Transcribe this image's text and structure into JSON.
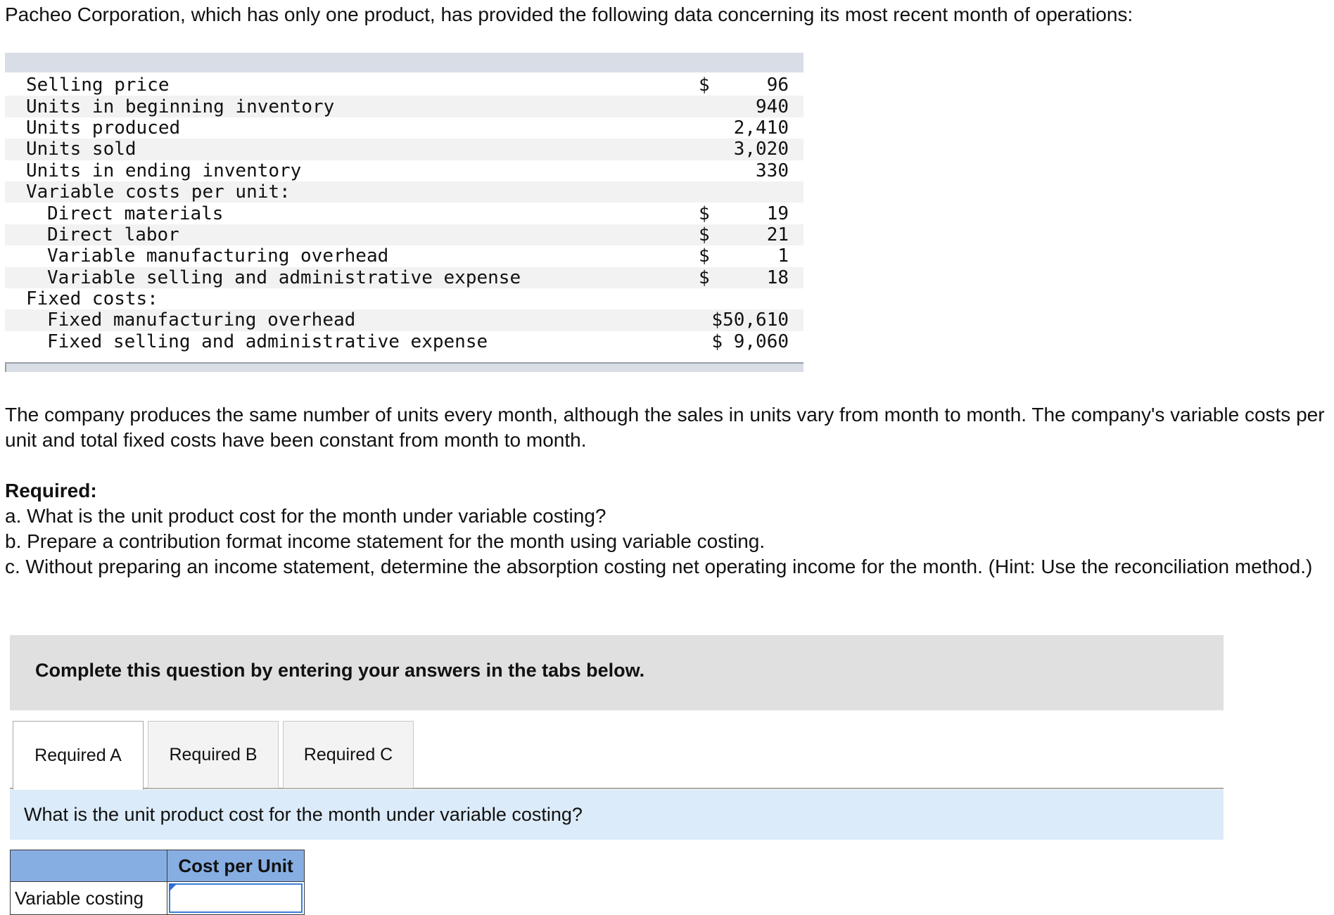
{
  "intro": "Pacheo Corporation, which has only one product, has provided the following data concerning its most recent month of operations:",
  "data_rows": [
    {
      "label": "Selling price",
      "cur": "$",
      "val": "96",
      "indent": false
    },
    {
      "label": "Units in beginning inventory",
      "cur": "",
      "val": "940",
      "indent": false
    },
    {
      "label": "Units produced",
      "cur": "",
      "val": "2,410",
      "indent": false
    },
    {
      "label": "Units sold",
      "cur": "",
      "val": "3,020",
      "indent": false
    },
    {
      "label": "Units in ending inventory",
      "cur": "",
      "val": "330",
      "indent": false
    },
    {
      "label": "Variable costs per unit:",
      "cur": "",
      "val": "",
      "indent": false
    },
    {
      "label": "Direct materials",
      "cur": "$",
      "val": "19",
      "indent": true
    },
    {
      "label": "Direct labor",
      "cur": "$",
      "val": "21",
      "indent": true
    },
    {
      "label": "Variable manufacturing overhead",
      "cur": "$",
      "val": "1",
      "indent": true
    },
    {
      "label": "Variable selling and administrative expense",
      "cur": "$",
      "val": "18",
      "indent": true
    },
    {
      "label": "Fixed costs:",
      "cur": "",
      "val": "",
      "indent": false
    },
    {
      "label": "Fixed manufacturing overhead",
      "combined": "$50,610",
      "indent": true
    },
    {
      "label": "Fixed selling and administrative expense",
      "combined": "$ 9,060",
      "indent": true
    }
  ],
  "paragraph": "The company produces the same number of units every month, although the sales in units vary from month to month. The company's variable costs per unit and total fixed costs have been constant from month to month.",
  "required": {
    "heading": "Required:",
    "a": "a. What is the unit product cost for the month under variable costing?",
    "b": "b. Prepare a contribution format income statement for the month using variable costing.",
    "c": "c. Without preparing an income statement, determine the absorption costing net operating income for the month. (Hint: Use the reconciliation method.)"
  },
  "banner": "Complete this question by entering your answers in the tabs below.",
  "tabs": [
    {
      "label": "Required A",
      "active": true
    },
    {
      "label": "Required B",
      "active": false
    },
    {
      "label": "Required C",
      "active": false
    }
  ],
  "question": "What is the unit product cost for the month under variable costing?",
  "answer_table": {
    "header": "Cost per Unit",
    "row_label": "Variable costing",
    "value": ""
  }
}
